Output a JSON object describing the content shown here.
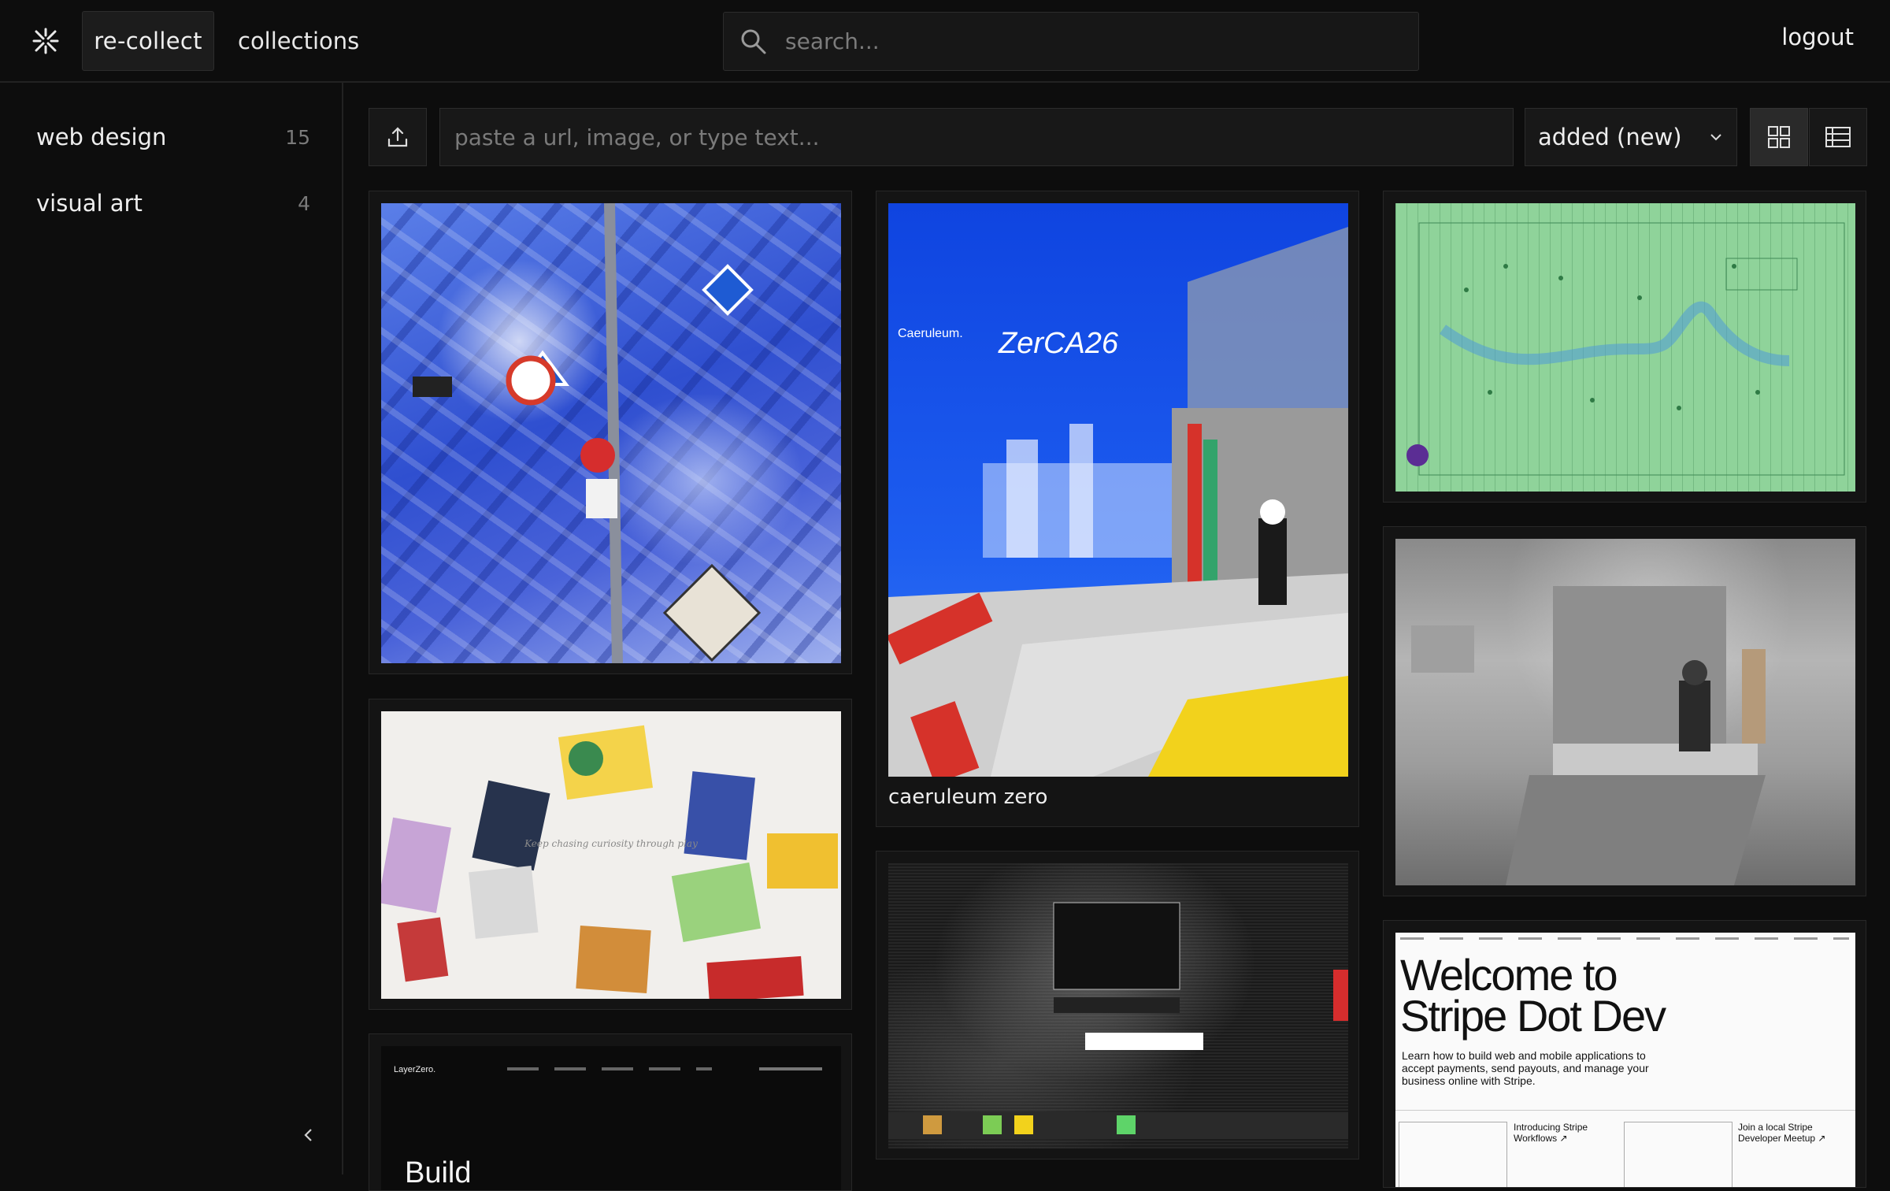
{
  "header": {
    "brand_label": "re-collect",
    "collections_label": "collections",
    "search_placeholder": "search...",
    "logout_label": "logout"
  },
  "sidebar": {
    "items": [
      {
        "label": "web design",
        "count": "15"
      },
      {
        "label": "visual art",
        "count": "4"
      }
    ]
  },
  "toolbar": {
    "add_placeholder": "paste a url, image, or type text...",
    "sort_value": "added (new)"
  },
  "cards": {
    "caeruleum": {
      "caption": "caeruleum zero",
      "art_title": "Caeruleum.",
      "art_mark": "ZerCA26"
    },
    "stripe": {
      "title_line1": "Welcome to",
      "title_line2": "Stripe Dot Dev",
      "subtitle": "Learn how to build web and mobile applications to accept payments, send payouts, and manage your business online with Stripe.",
      "video1": "Introducing Stripe Workflows ↗",
      "video2": "Join a local Stripe Developer Meetup ↗"
    },
    "layerzero": {
      "brand": "LayerZero.",
      "headline": "Build"
    },
    "collage": {
      "tagline": "Keep chasing curiosity through play"
    }
  },
  "colors": {
    "background": "#0d0d0d",
    "panel": "#181818",
    "border": "#2c2c2c",
    "text": "#eeeeee",
    "muted": "#7a7a7a"
  }
}
